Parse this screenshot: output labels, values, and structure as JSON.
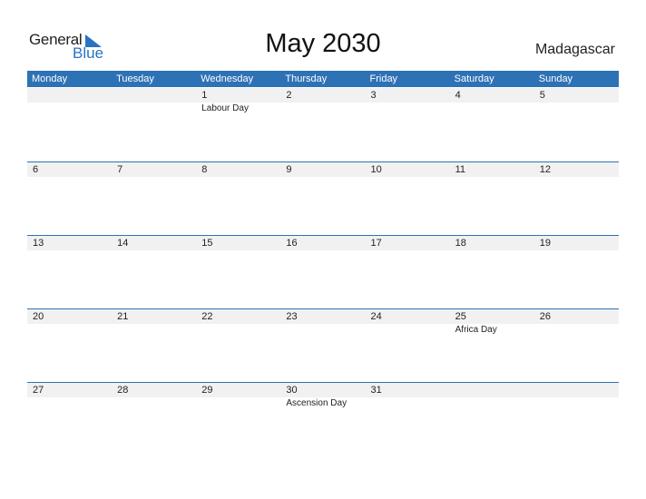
{
  "logo": {
    "line1": "General",
    "line2": "Blue"
  },
  "title": "May 2030",
  "country": "Madagascar",
  "weekdays": [
    "Monday",
    "Tuesday",
    "Wednesday",
    "Thursday",
    "Friday",
    "Saturday",
    "Sunday"
  ],
  "weeks": [
    {
      "days": [
        "",
        "",
        "1",
        "2",
        "3",
        "4",
        "5"
      ],
      "events": [
        "",
        "",
        "Labour Day",
        "",
        "",
        "",
        ""
      ]
    },
    {
      "days": [
        "6",
        "7",
        "8",
        "9",
        "10",
        "11",
        "12"
      ],
      "events": [
        "",
        "",
        "",
        "",
        "",
        "",
        ""
      ]
    },
    {
      "days": [
        "13",
        "14",
        "15",
        "16",
        "17",
        "18",
        "19"
      ],
      "events": [
        "",
        "",
        "",
        "",
        "",
        "",
        ""
      ]
    },
    {
      "days": [
        "20",
        "21",
        "22",
        "23",
        "24",
        "25",
        "26"
      ],
      "events": [
        "",
        "",
        "",
        "",
        "",
        "Africa Day",
        ""
      ]
    },
    {
      "days": [
        "27",
        "28",
        "29",
        "30",
        "31",
        "",
        ""
      ],
      "events": [
        "",
        "",
        "",
        "Ascension Day",
        "",
        "",
        ""
      ]
    }
  ],
  "colors": {
    "accent": "#2e72b6",
    "band": "#f1f1f1"
  }
}
